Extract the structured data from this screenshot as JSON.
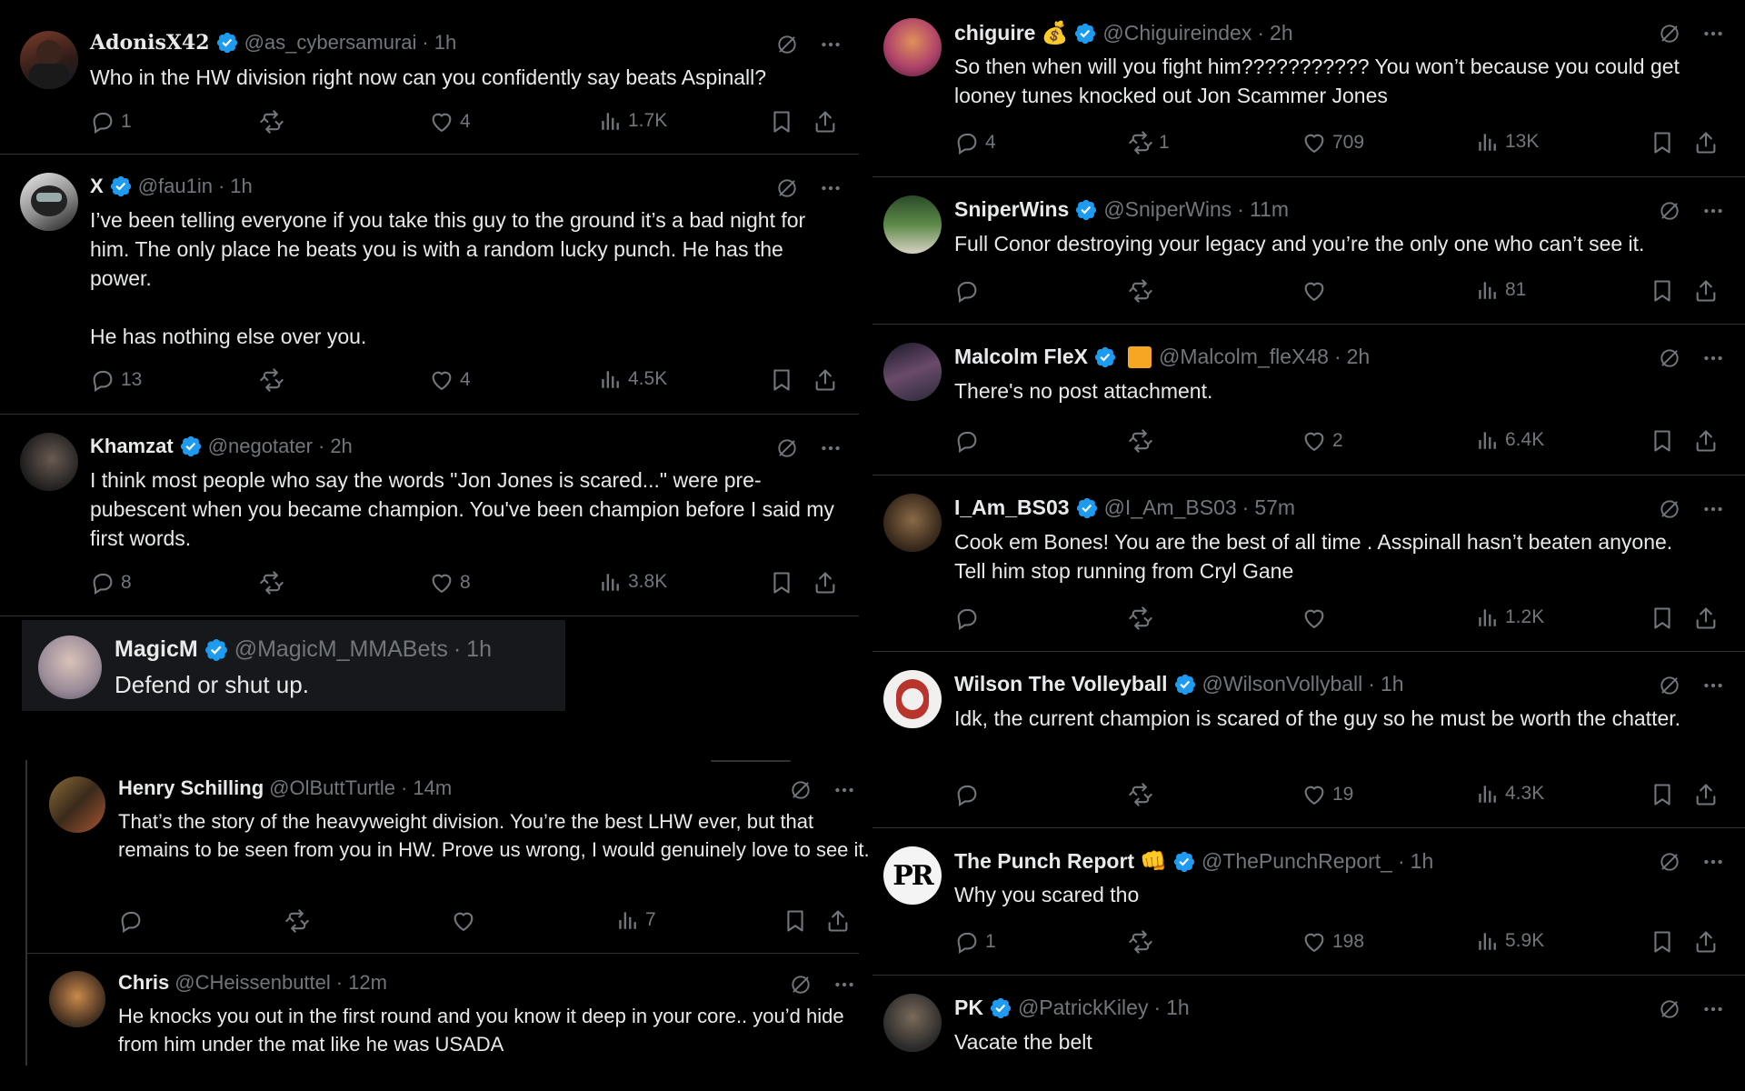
{
  "left": {
    "tweets": [
      {
        "name": "AdonisX42",
        "handle": "@as_cybersamurai",
        "time": "1h",
        "text": "Who in the HW division right now can you confidently say beats Aspinall?",
        "replies": "1",
        "reposts": "",
        "likes": "4",
        "views": "1.7K"
      },
      {
        "name": "X",
        "handle": "@fau1in",
        "time": "1h",
        "text": "I’ve been telling everyone if you take this guy to the ground it’s a bad night for him. The only place he beats you is with a random lucky punch. He has the power.\n\nHe has nothing else over you.",
        "replies": "13",
        "reposts": "",
        "likes": "4",
        "views": "4.5K"
      },
      {
        "name": "Khamzat",
        "handle": "@negotater",
        "time": "2h",
        "text": "I think most people who say the words \"Jon Jones is scared...\" were pre-pubescent when you became champion. You've been champion before I said my first words.",
        "replies": "8",
        "reposts": "",
        "likes": "8",
        "views": "3.8K"
      }
    ],
    "magic": {
      "name": "MagicM",
      "handle": "@MagicM_MMABets",
      "time": "1h",
      "text": "Defend or shut up."
    },
    "thread": [
      {
        "name": "Henry Schilling",
        "handle": "@OlButtTurtle",
        "time": "14m",
        "text": "That’s the story of the heavyweight division. You’re the best LHW ever, but that remains to be seen from you in HW. Prove us wrong, I would genuinely love to see it.",
        "replies": "",
        "reposts": "",
        "likes": "",
        "views": "7"
      },
      {
        "name": "Chris",
        "handle": "@CHeissenbuttel",
        "time": "12m",
        "text": "He knocks you out in the first round and you know it deep in your core.. you’d hide from him under the mat like he was USADA"
      }
    ]
  },
  "right": {
    "tweets": [
      {
        "name": "chiguire",
        "emoji": "💰",
        "handle": "@Chiguireindex",
        "time": "2h",
        "text": "So then when will you fight him??????????? You won’t because you could get looney tunes knocked out Jon Scammer Jones",
        "replies": "4",
        "reposts": "1",
        "likes": "709",
        "views": "13K"
      },
      {
        "name": "SniperWins",
        "emoji": "",
        "handle": "@SniperWins",
        "time": "11m",
        "text": "Full Conor destroying your legacy and you’re the only one who can’t see it.",
        "replies": "",
        "reposts": "",
        "likes": "",
        "views": "81"
      },
      {
        "name": "Malcolm FleX",
        "emoji": "",
        "handle": "@Malcolm_fleX48",
        "time": "2h",
        "text": "There's no post attachment.",
        "replies": "",
        "reposts": "",
        "likes": "2",
        "views": "6.4K"
      },
      {
        "name": "I_Am_BS03",
        "emoji": "",
        "handle": "@I_Am_BS03",
        "time": "57m",
        "text": "Cook em Bones! You are the best of all time . Asspinall hasn’t beaten anyone. Tell him stop running from Cryl Gane",
        "replies": "",
        "reposts": "",
        "likes": "",
        "views": "1.2K"
      },
      {
        "name": "Wilson The Volleyball",
        "emoji": "",
        "handle": "@WilsonVollyball",
        "time": "1h",
        "text": "Idk, the current champion is scared of the guy so he must be worth the chatter.",
        "replies": "",
        "reposts": "",
        "likes": "19",
        "views": "4.3K"
      },
      {
        "name": "The Punch Report",
        "emoji": "👊",
        "handle": "@ThePunchReport_",
        "time": "1h",
        "text": "Why you scared tho",
        "replies": "1",
        "reposts": "",
        "likes": "198",
        "views": "5.9K"
      },
      {
        "name": "PK",
        "emoji": "",
        "handle": "@PatrickKiley",
        "time": "1h",
        "text": "Vacate the belt"
      }
    ]
  },
  "avatars": {
    "punch_report_initials": "PR"
  },
  "icons": [
    "reply-icon",
    "repost-icon",
    "like-icon",
    "views-icon",
    "bookmark-icon",
    "share-icon",
    "grok-icon",
    "more-icon",
    "verified-icon"
  ],
  "colors": {
    "background": "#000000",
    "text": "#e7e9ea",
    "muted": "#71767b",
    "verified": "#1d9bf0",
    "divider": "#2f3336"
  }
}
